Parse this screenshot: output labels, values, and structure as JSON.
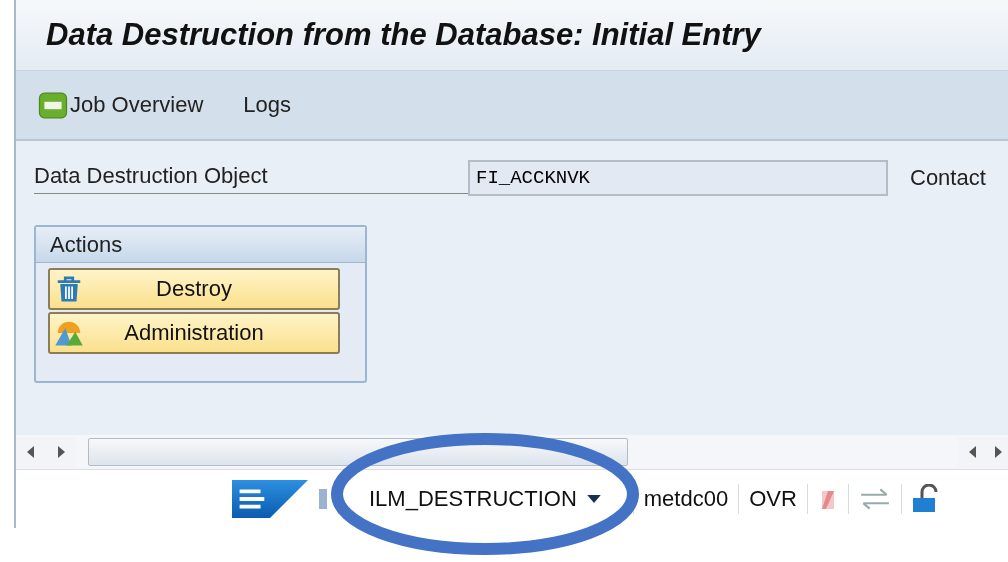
{
  "window": {
    "title": "Data Destruction from the Database: Initial Entry"
  },
  "toolbar": [
    {
      "label": "Job Overview",
      "kind": "job"
    },
    {
      "label": "Logs",
      "kind": "plain"
    }
  ],
  "fields": [
    {
      "label": "Data Destruction Object",
      "value": "FI_ACCKNVK"
    }
  ],
  "side_label": "Contact",
  "actions": {
    "title": "Actions",
    "buttons": [
      {
        "label": "Destroy",
        "kind": "trash"
      },
      {
        "label": "Administration",
        "kind": "mountain"
      }
    ]
  },
  "status_bar": {
    "system": "ILM_DESTRUCTION",
    "client": "metdc00",
    "mode": "OVR"
  }
}
